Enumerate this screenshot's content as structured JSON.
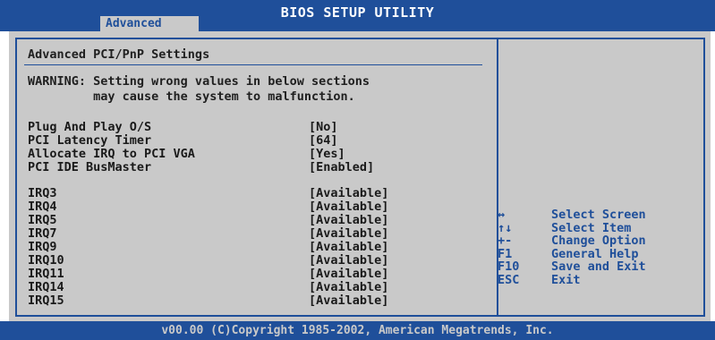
{
  "header": {
    "title": "BIOS SETUP UTILITY",
    "active_tab": "Advanced"
  },
  "page": {
    "section_title": "Advanced PCI/PnP Settings",
    "warning_line1": "WARNING: Setting wrong values in below sections",
    "warning_line2": "         may cause the system to malfunction."
  },
  "settings": [
    {
      "label": "Plug And Play O/S",
      "value": "[No]"
    },
    {
      "label": "PCI Latency Timer",
      "value": "[64]"
    },
    {
      "label": "Allocate IRQ to PCI VGA",
      "value": "[Yes]"
    },
    {
      "label": "PCI IDE BusMaster",
      "value": "[Enabled]"
    }
  ],
  "irqs": [
    {
      "label": "IRQ3",
      "value": "[Available]"
    },
    {
      "label": "IRQ4",
      "value": "[Available]"
    },
    {
      "label": "IRQ5",
      "value": "[Available]"
    },
    {
      "label": "IRQ7",
      "value": "[Available]"
    },
    {
      "label": "IRQ9",
      "value": "[Available]"
    },
    {
      "label": "IRQ10",
      "value": "[Available]"
    },
    {
      "label": "IRQ11",
      "value": "[Available]"
    },
    {
      "label": "IRQ14",
      "value": "[Available]"
    },
    {
      "label": "IRQ15",
      "value": "[Available]"
    }
  ],
  "help": [
    {
      "key": "↔",
      "desc": "Select Screen"
    },
    {
      "key": "↑↓",
      "desc": "Select Item"
    },
    {
      "key": "+-",
      "desc": "Change Option"
    },
    {
      "key": "F1",
      "desc": "General Help"
    },
    {
      "key": "F10",
      "desc": "Save and Exit"
    },
    {
      "key": "ESC",
      "desc": "Exit"
    }
  ],
  "footer": {
    "copyright": "v00.00 (C)Copyright 1985-2002, American Megatrends, Inc."
  },
  "colors": {
    "bios_blue": "#1f4f9a",
    "panel_gray": "#c9c9c9"
  }
}
